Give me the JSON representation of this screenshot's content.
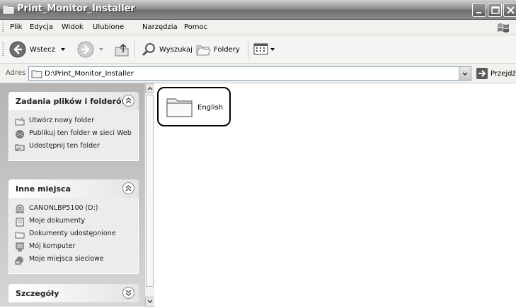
{
  "window": {
    "title": "Print_Monitor_Installer"
  },
  "menu": [
    "Plik",
    "Edycja",
    "Widok",
    "Ulubione",
    "Narzędzia",
    "Pomoc"
  ],
  "toolbar": {
    "back_label": "Wstecz",
    "search_label": "Wyszukaj",
    "folders_label": "Foldery"
  },
  "address": {
    "label": "Adres",
    "value": "D:\\Print_Monitor_Installer",
    "go_label": "Przejdź"
  },
  "tasks_panel": {
    "title": "Zadania plików i folderów",
    "items": [
      "Utwórz nowy folder",
      "Publikuj ten folder w sieci Web",
      "Udostępnij ten folder"
    ]
  },
  "places_panel": {
    "title": "Inne miejsca",
    "items": [
      "CANONLBP5100 (D:)",
      "Moje dokumenty",
      "Dokumenty udostępnione",
      "Mój komputer",
      "Moje miejsca sieciowe"
    ]
  },
  "details_panel": {
    "title": "Szczegóły"
  },
  "files": [
    {
      "name": "English",
      "icon": "folder-icon"
    }
  ]
}
